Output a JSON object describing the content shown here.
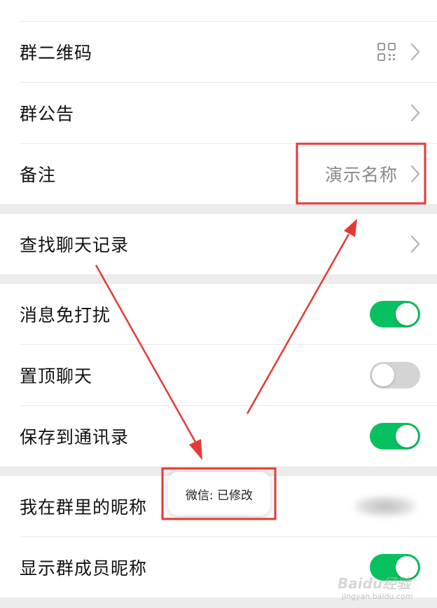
{
  "rows": {
    "qrcode": {
      "label": "群二维码"
    },
    "notice": {
      "label": "群公告"
    },
    "remark": {
      "label": "备注",
      "value": "演示名称"
    },
    "search": {
      "label": "查找聊天记录"
    },
    "mute": {
      "label": "消息免打扰",
      "on": true
    },
    "pin": {
      "label": "置顶聊天",
      "on": false
    },
    "save_contacts": {
      "label": "保存到通讯录",
      "on": true
    },
    "my_nickname": {
      "label": "我在群里的昵称"
    },
    "show_nicknames": {
      "label": "显示群成员昵称",
      "on": true
    }
  },
  "toast": {
    "text": "微信: 已修改"
  },
  "icons": {
    "qrcode": "qr-code-icon",
    "chevron": "chevron-right-icon"
  },
  "colors": {
    "toggle_on": "#07c160",
    "toggle_off": "#d4d4d4",
    "annotation": "#e53935",
    "section_gap": "#ececec"
  },
  "watermark": {
    "logo": "Baidu经验",
    "url": "jingyan.baidu.com"
  }
}
